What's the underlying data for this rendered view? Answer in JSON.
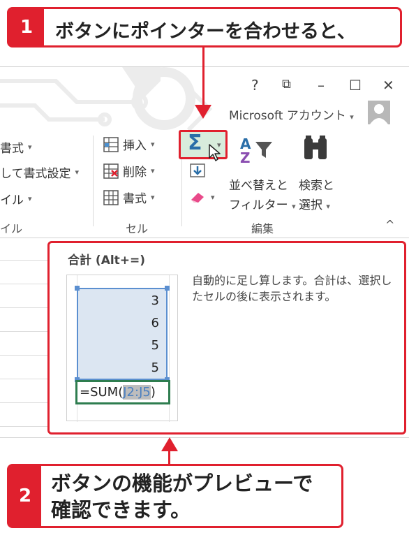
{
  "callout1": {
    "number": "1",
    "text": "ボタンにポインターを合わせると、"
  },
  "callout2": {
    "number": "2",
    "line1": "ボタンの機能がプレビューで",
    "line2": "確認できます。"
  },
  "window_controls": {
    "help": "?",
    "restore": "⧉",
    "minimize": "–",
    "maximize": "☐",
    "close": "✕"
  },
  "account": {
    "label": "Microsoft アカウント",
    "caret": "▾"
  },
  "ribbon": {
    "styles_items": [
      "書式",
      "して書式設定",
      "イル"
    ],
    "styles_group": "イル",
    "cells": {
      "insert": "挿入",
      "delete": "削除",
      "format": "書式",
      "group": "セル"
    },
    "editing": {
      "sort_filter_line1": "並べ替えと",
      "sort_filter_line2": "フィルター",
      "find_select_line1": "検索と",
      "find_select_line2": "選択",
      "group": "編集",
      "collapse": "^"
    }
  },
  "tooltip": {
    "title": "合計 (Alt+=)",
    "description": "自動的に足し算します。合計は、選択したセルの後に表示されます。",
    "preview_values": [
      "3",
      "6",
      "5",
      "5"
    ],
    "formula_prefix": "=SUM(",
    "formula_ref": "J2:J5",
    "formula_suffix": ")"
  },
  "colors": {
    "accent": "#e0202e",
    "selection": "#dce6f2",
    "formula_border": "#2e7d4f"
  }
}
